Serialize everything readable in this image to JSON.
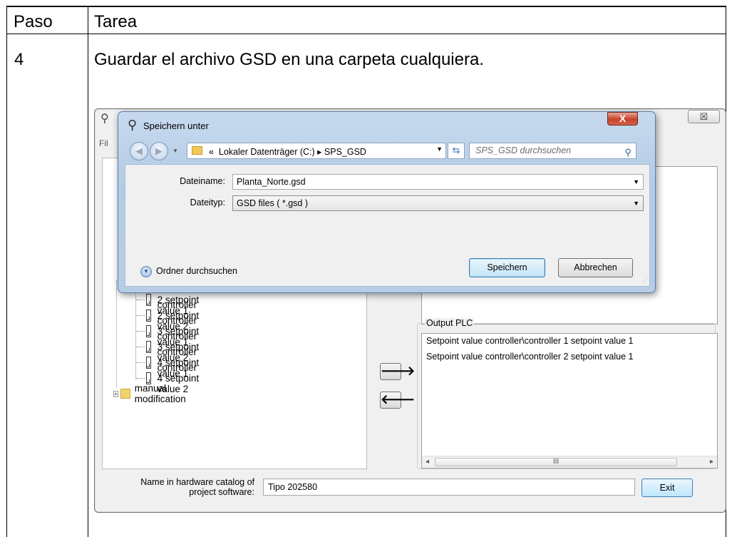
{
  "doc_table": {
    "header_step": "Paso",
    "header_task": "Tarea",
    "step_number": "4",
    "step_text": "Guardar el archivo GSD en una carpeta cualquiera."
  },
  "app": {
    "menu_text": "Fil",
    "close_glyph": "☒",
    "tree_items": [
      "controller 2 setpoint value 1",
      "controller 2 setpoint value 2",
      "controller 3 setpoint value 1",
      "controller 3 setpoint value 2",
      "controller 4 setpoint value 1",
      "controller 4 setpoint value 2"
    ],
    "tree_folder": "manual modification",
    "arrow_right": "🡒",
    "arrow_left": "🡐",
    "output_group_label": "Output PLC",
    "output_items": [
      "Setpoint value controller\\controller 1 setpoint value 1",
      "Setpoint value controller\\controller 2 setpoint value 1"
    ],
    "scroll_thumb": "III",
    "hw_label_line1": "Name in hardware catalog of",
    "hw_label_line2": "project software:",
    "hw_value": "Tipo 202580",
    "exit_label": "Exit"
  },
  "dialog": {
    "title": "Speichern unter",
    "close_glyph": "X",
    "address_chevron": "«",
    "address_path": "Lokaler Datenträger (C:)  ▸  SPS_GSD",
    "search_placeholder": "SPS_GSD durchsuchen",
    "filename_label": "Dateiname:",
    "filename_value": "Planta_Norte.gsd",
    "filetype_label": "Dateityp:",
    "filetype_value": "GSD files ( *.gsd )",
    "browse_label": "Ordner durchsuchen",
    "save_label": "Speichern",
    "cancel_label": "Abbrechen"
  }
}
